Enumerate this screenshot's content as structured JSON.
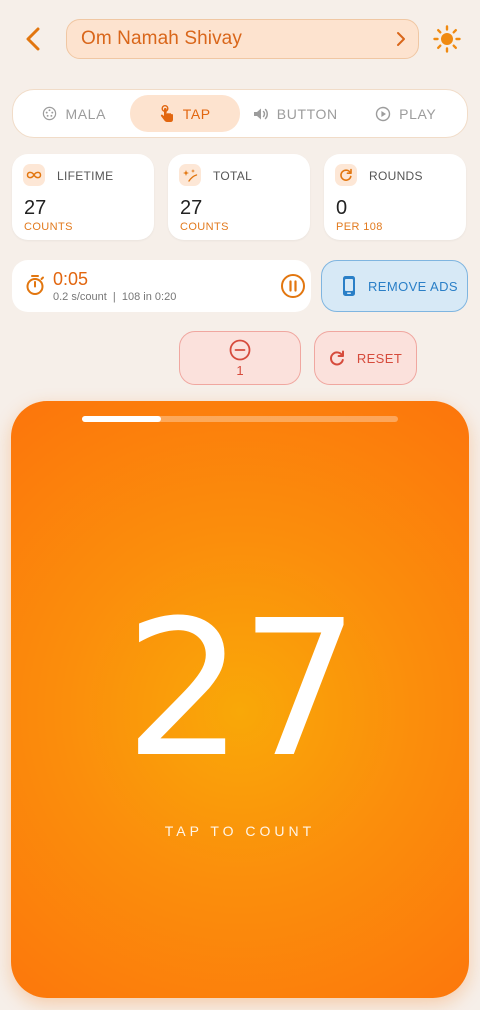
{
  "header": {
    "mantra_title": "Om Namah Shivay"
  },
  "modes": [
    {
      "label": "MALA",
      "icon": "mala-beads-icon",
      "active": false
    },
    {
      "label": "TAP",
      "icon": "tap-hand-icon",
      "active": true
    },
    {
      "label": "BUTTON",
      "icon": "speaker-icon",
      "active": false
    },
    {
      "label": "PLAY",
      "icon": "play-icon",
      "active": false
    }
  ],
  "stats": {
    "lifetime": {
      "label": "LIFETIME",
      "value": "27",
      "sub": "COUNTS"
    },
    "total": {
      "label": "TOTAL",
      "value": "27",
      "sub": "COUNTS"
    },
    "rounds": {
      "label": "ROUNDS",
      "value": "0",
      "sub": "PER 108"
    }
  },
  "timer": {
    "elapsed": "0:05",
    "rate": "0.2 s/count  |  108 in 0:20"
  },
  "remove_ads": {
    "label": "REMOVE ADS"
  },
  "decrement": {
    "value": "1"
  },
  "reset": {
    "label": "RESET"
  },
  "counter": {
    "count": "27",
    "hint": "TAP TO COUNT",
    "progress": 0.25
  },
  "colors": {
    "accent": "#e2660f",
    "tap_gradient_center": "#f9a808",
    "tap_gradient_edge": "#fc750c",
    "remove_ads_blue": "#2a7fc7",
    "danger": "#d64b3c"
  }
}
